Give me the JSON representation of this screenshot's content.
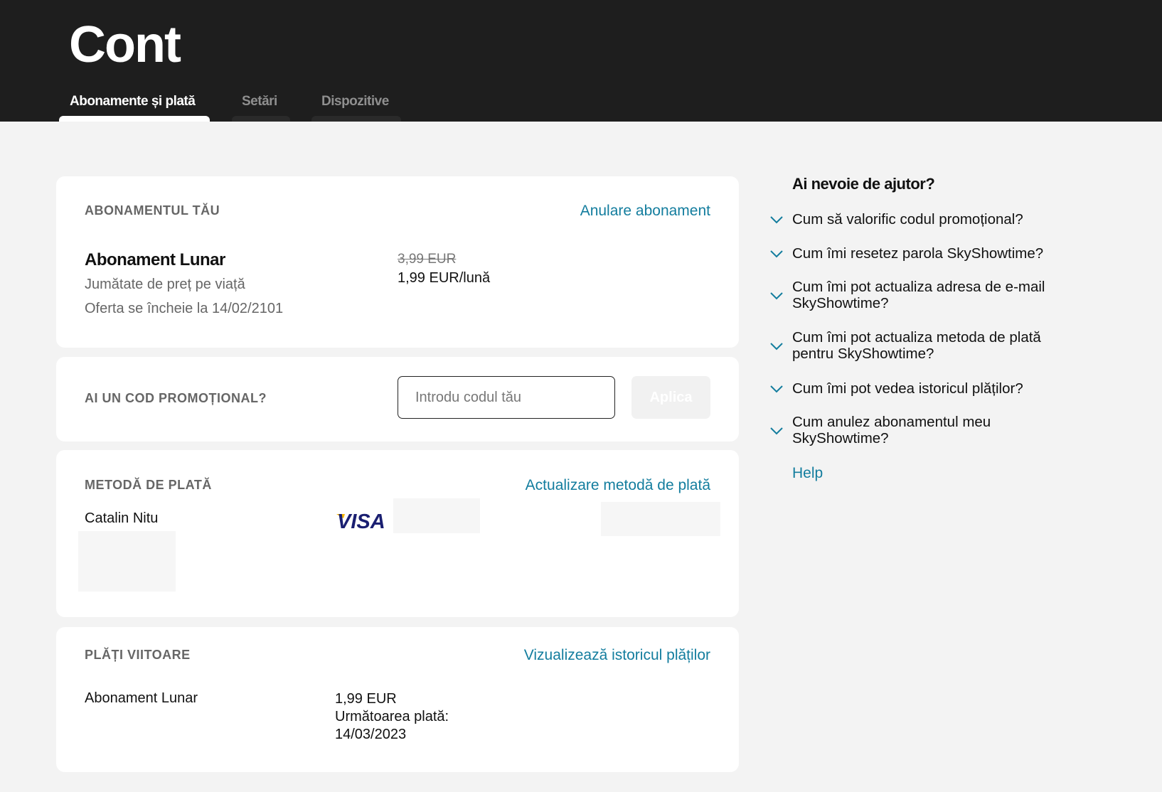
{
  "header": {
    "title": "Cont",
    "tabs": [
      {
        "label": "Abonamente și plată",
        "active": true
      },
      {
        "label": "Setări",
        "active": false
      },
      {
        "label": "Dispozitive",
        "active": false
      }
    ]
  },
  "subscription": {
    "section_label": "ABONAMENTUL TĂU",
    "cancel_link": "Anulare abonament",
    "plan_name": "Abonament Lunar",
    "discount_text": "Jumătate de preț pe viață",
    "offer_end": "Oferta se încheie la 14/02/2101",
    "old_price": "3,99 EUR",
    "new_price": "1,99 EUR/lună"
  },
  "promo": {
    "section_label": "AI UN COD PROMOȚIONAL?",
    "placeholder": "Introdu codul tău",
    "apply_label": "Aplica"
  },
  "payment_method": {
    "section_label": "METODĂ DE PLATĂ",
    "update_link": "Actualizare metodă de plată",
    "card_holder": "Catalin Nitu",
    "card_brand": "VISA"
  },
  "future_payments": {
    "section_label": "PLĂȚI VIITOARE",
    "history_link": "Vizualizează istoricul plăților",
    "plan_name": "Abonament Lunar",
    "amount": "1,99 EUR",
    "next_payment_label": "Următoarea plată:",
    "next_payment_date": "14/03/2023"
  },
  "help": {
    "title": "Ai nevoie de ajutor?",
    "faq": [
      {
        "line1": "Cum să valorific codul promoțional?",
        "line2": ""
      },
      {
        "line1": "Cum îmi resetez parola SkyShowtime?",
        "line2": ""
      },
      {
        "line1": "Cum îmi pot actualiza adresa de e-mail",
        "line2": "SkyShowtime?"
      },
      {
        "line1": "Cum îmi pot actualiza metoda de plată",
        "line2": "pentru SkyShowtime?"
      },
      {
        "line1": "Cum îmi pot vedea istoricul plăților?",
        "line2": ""
      },
      {
        "line1": "Cum anulez abonamentul meu",
        "line2": "SkyShowtime?"
      }
    ],
    "help_link": "Help"
  },
  "colors": {
    "header_bg": "#1e1e1e",
    "page_bg": "#f3f3f3",
    "link": "#137d9e",
    "visa_blue": "#1a1f71",
    "visa_gold": "#f7b600"
  }
}
